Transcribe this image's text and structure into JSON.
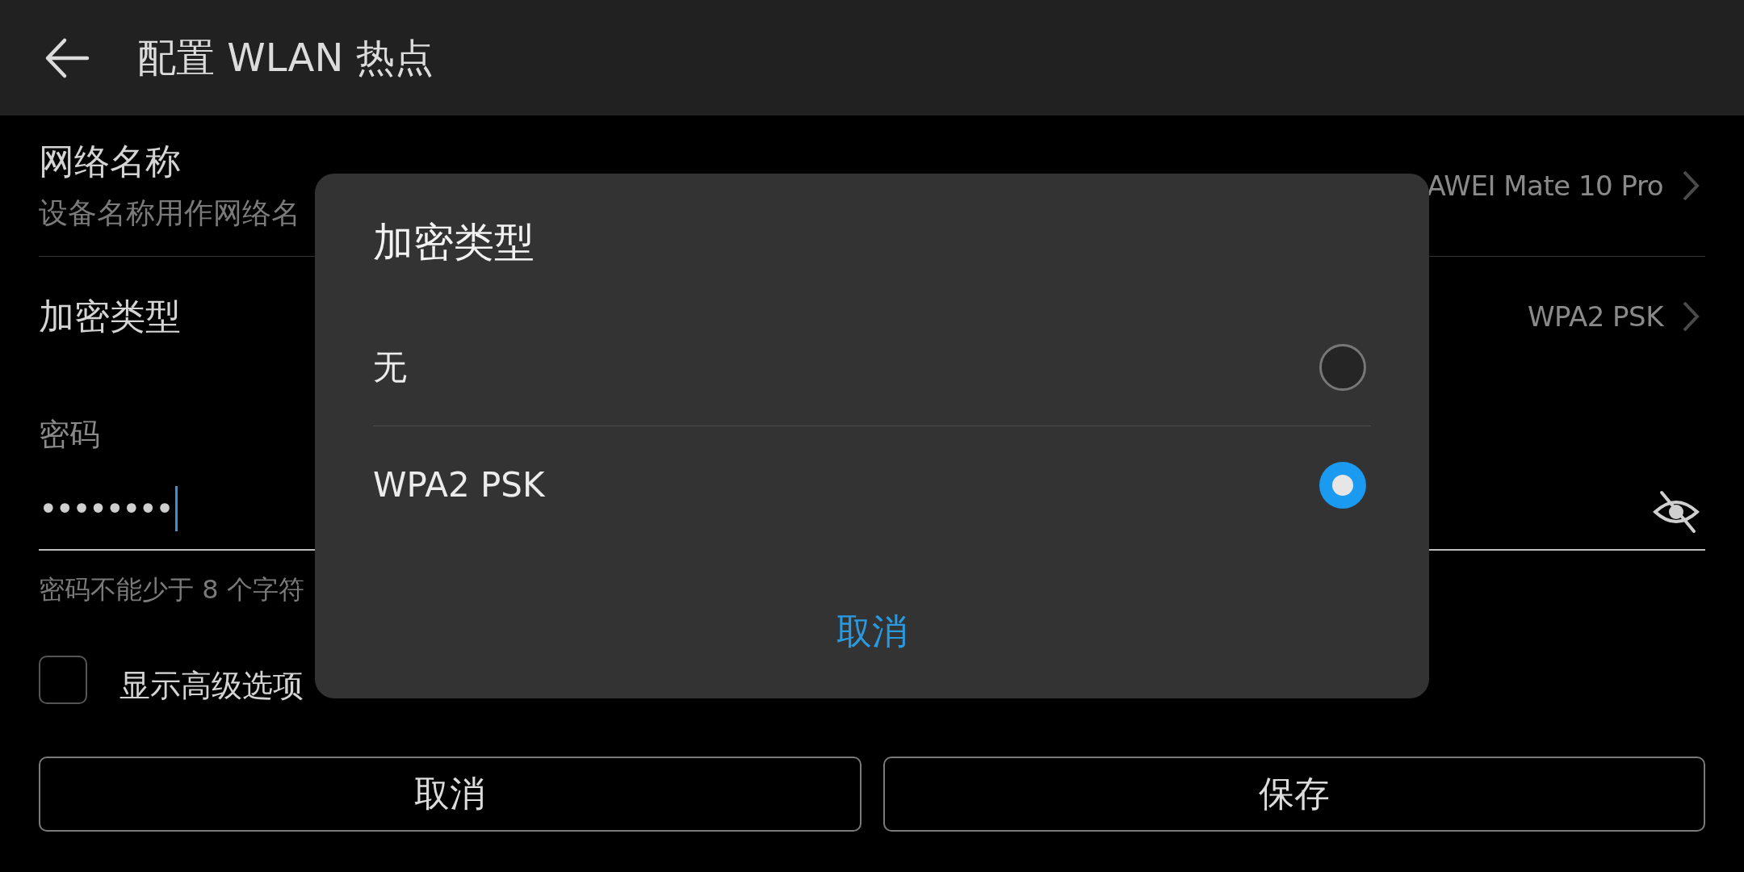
{
  "app_bar": {
    "title": "配置 WLAN 热点"
  },
  "settings": [
    {
      "label": "网络名称",
      "description": "设备名称用作网络名",
      "value": "AWEI Mate 10 Pro"
    },
    {
      "label": "加密类型",
      "value": "WPA2 PSK"
    }
  ],
  "password": {
    "label": "密码",
    "value": "••••••••",
    "hint": "密码不能少于 8 个字符",
    "visible": false
  },
  "advanced_option": {
    "label": "显示高级选项",
    "checked": false
  },
  "buttons": [
    "取消",
    "保存"
  ],
  "dialog": {
    "title": "加密类型",
    "options": [
      {
        "label": "无",
        "selected": false
      },
      {
        "label": "WPA2 PSK",
        "selected": true
      }
    ],
    "cancel": "取消"
  }
}
